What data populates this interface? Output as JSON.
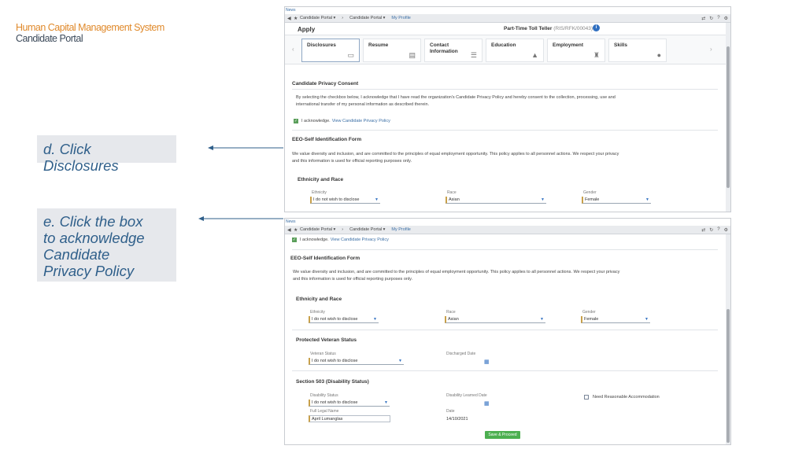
{
  "brand": {
    "line1": "Human Capital Management System",
    "line2": "Candidate Portal"
  },
  "callouts": {
    "d": "d. Click Disclosures",
    "e_lines": [
      "e. Click the box",
      "to  acknowledge",
      "Candidate",
      "Privacy  Policy"
    ]
  },
  "colors": {
    "brand_orange": "#e08a2c",
    "callout_text": "#2f5f8a",
    "accent_blue": "#2f6fc0",
    "check_green": "#5a9e5a",
    "save_green": "#4caf50"
  },
  "browser": {
    "news": "News",
    "crumbs": [
      "Candidate Portal",
      "Candidate Portal",
      "My Profile"
    ],
    "icons": [
      "back-icon",
      "star-icon",
      "shuffle-icon",
      "refresh-icon",
      "help-icon",
      "gear-icon"
    ]
  },
  "top": {
    "apply": "Apply",
    "job_title": "Part-Time Toll Teller",
    "job_code": "(RIS/RFK/00043)",
    "tabs": [
      "Disclosures",
      "Resume",
      "Contact Information",
      "Education",
      "Employment",
      "Skills"
    ],
    "consent_title": "Candidate Privacy Consent",
    "consent_text_1": "By selecting the checkbox below, I acknowledge that I have read the organization's Candidate Privacy Policy and hereby consent to the collection, processing, use and",
    "consent_text_2": "international transfer of my personal information as described therein.",
    "ack_label": "I acknowledge.",
    "ack_link": "View Candidate Privacy Policy",
    "eeo_title": "EEO-Self Identification Form",
    "eeo_text_1": "We value diversity and inclusion, and are committed to the principles of equal employment opportunity. This policy applies to all personnel actions. We respect your privacy",
    "eeo_text_2": "and this information is used for official reporting purposes only.",
    "ethnicity_race_title": "Ethnicity and Race",
    "ethnicity_label": "Ethnicity",
    "ethnicity_value": "I do not wish to disclose",
    "race_label": "Race",
    "race_value": "Asian",
    "gender_label": "Gender",
    "gender_value": "Female"
  },
  "bottom": {
    "ack_label": "I acknowledge.",
    "ack_link": "View Candidate Privacy Policy",
    "eeo_title": "EEO-Self Identification Form",
    "eeo_text_1": "We value diversity and inclusion, and are committed to the principles of equal employment opportunity. This policy applies to all personnel actions. We respect your privacy",
    "eeo_text_2": "and this information is used for official reporting purposes only.",
    "ethnicity_race_title": "Ethnicity and Race",
    "ethnicity_label": "Ethnicity",
    "ethnicity_value": "I do not wish to disclose",
    "race_label": "Race",
    "race_value": "Asian",
    "gender_label": "Gender",
    "gender_value": "Female",
    "veteran_title": "Protected Veteran Status",
    "veteran_label": "Veteran Status",
    "veteran_value": "I do not wish to disclose",
    "discharged_label": "Discharged Date",
    "section503_title": "Section 503 (Disability Status)",
    "disability_label": "Disability Status",
    "disability_value": "I do not wish to disclose",
    "disability_learned_label": "Disability Learned Date",
    "accommodation_label": "Need Reasonable Accommodation",
    "legal_name_label": "Full Legal Name",
    "legal_name_value": "April Lumanglas",
    "date_label": "Date",
    "date_value": "14/10/2021",
    "save_button": "Save & Proceed"
  }
}
